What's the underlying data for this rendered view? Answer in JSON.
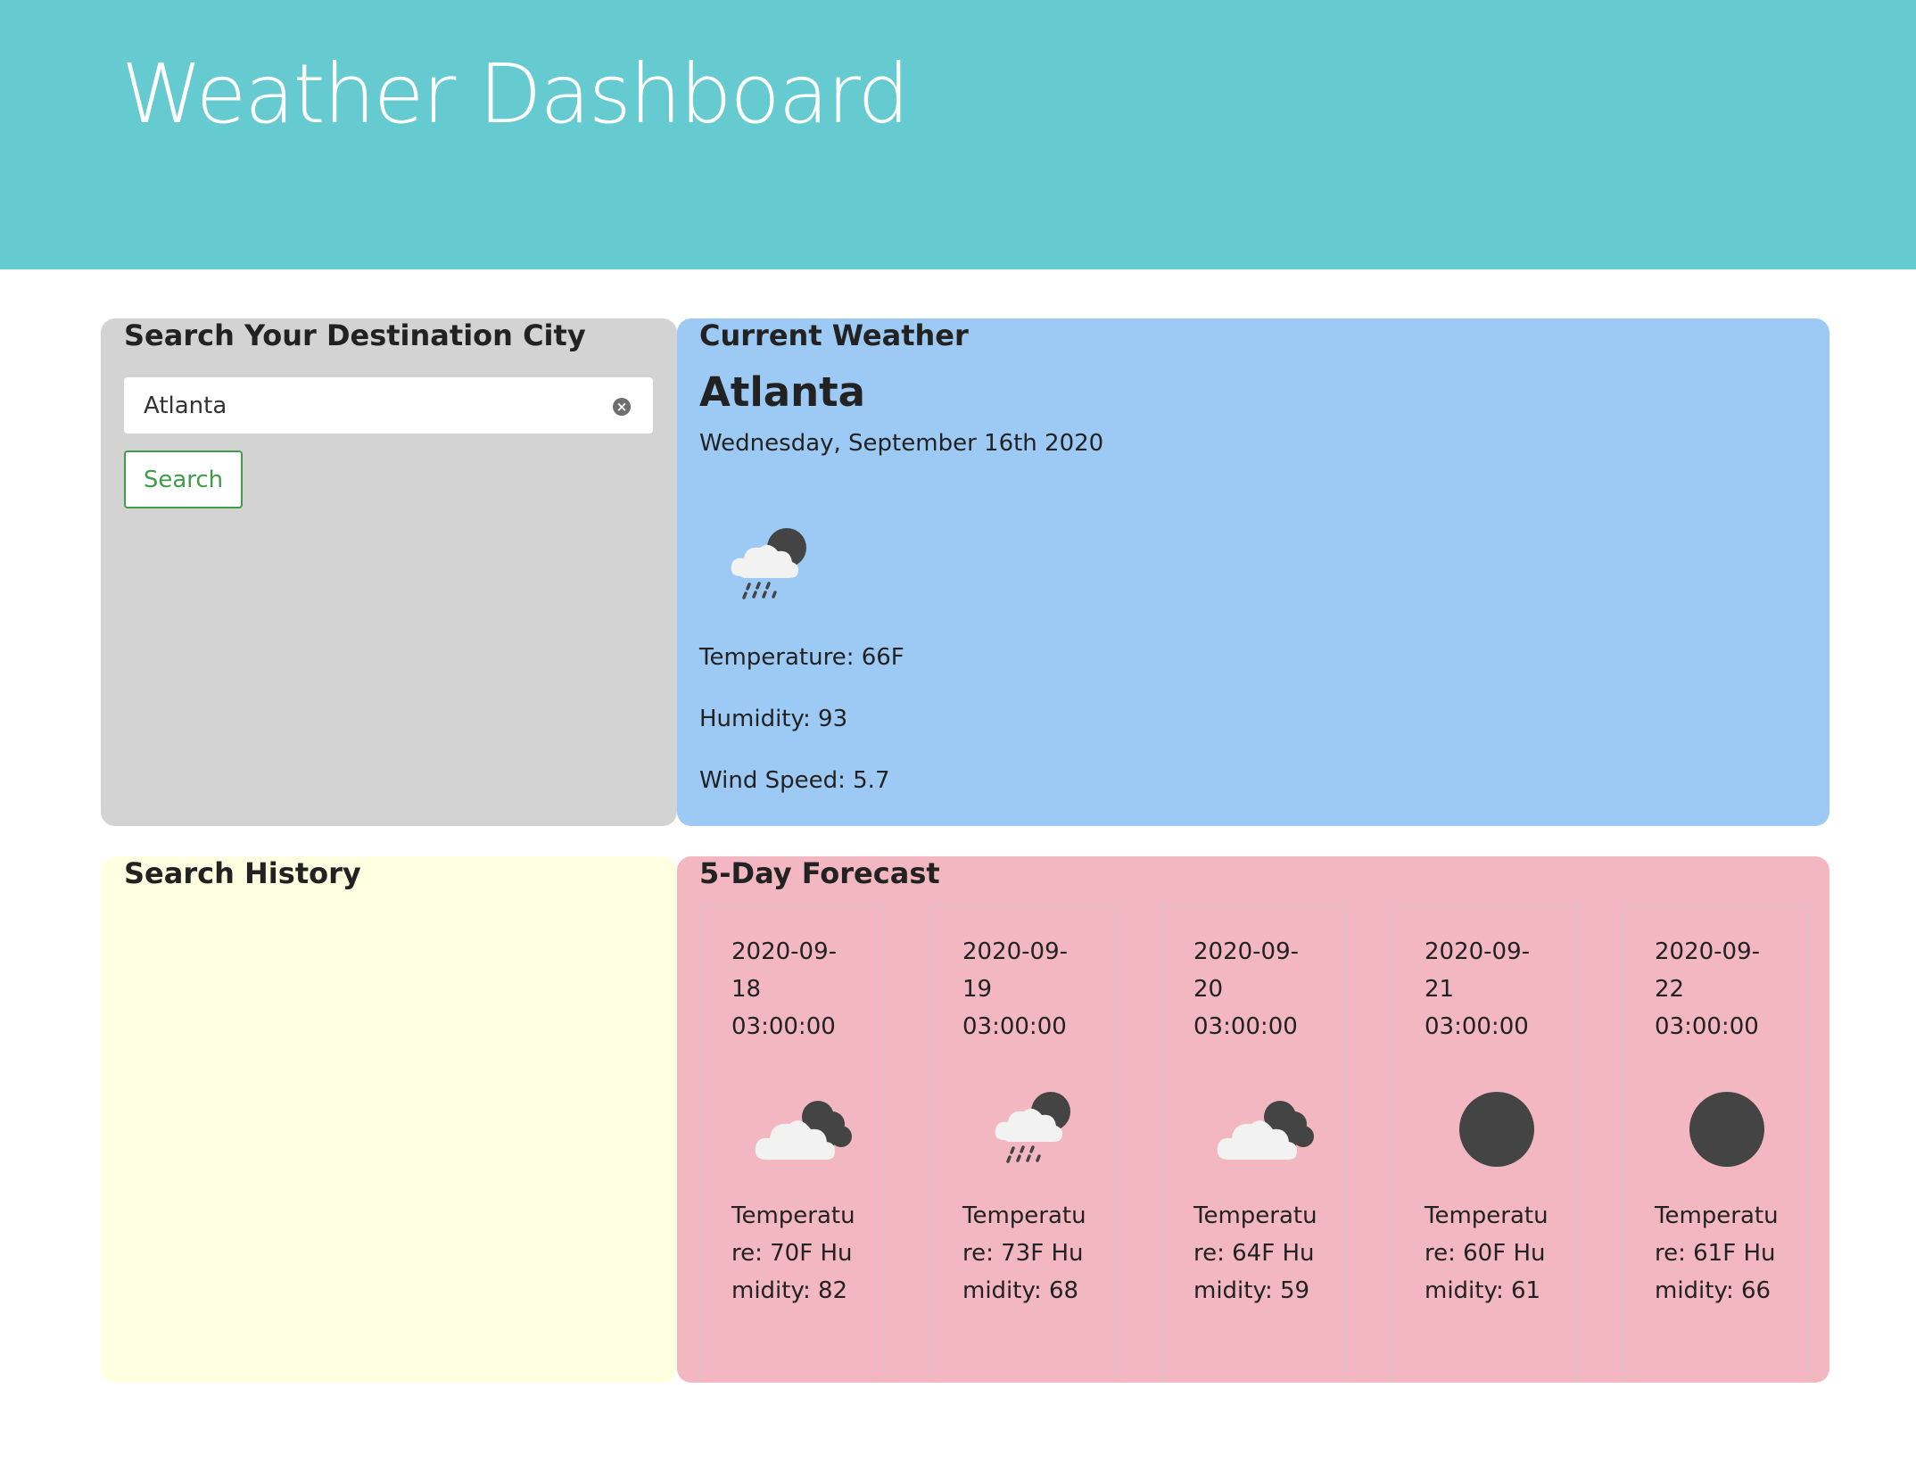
{
  "header": {
    "title": "Weather Dashboard"
  },
  "search_panel": {
    "heading": "Search Your Destination City",
    "input_value": "Atlanta",
    "clear_symbol": "×",
    "search_label": "Search"
  },
  "current": {
    "heading": "Current Weather",
    "city": "Atlanta",
    "date": "Wednesday, September 16th 2020",
    "icon": "night-cloud-rain-icon",
    "temperature": "Temperature: 66F",
    "humidity": "Humidity: 93",
    "wind": "Wind Speed: 5.7"
  },
  "history": {
    "heading": "Search History",
    "items": []
  },
  "forecast": {
    "heading": "5-Day Forecast",
    "cards": [
      {
        "datetime": "2020-09-18 03:00:00",
        "icon": "night-clouds-icon",
        "temp_humidity": "Temperature: 70F Humidity: 82"
      },
      {
        "datetime": "2020-09-19 03:00:00",
        "icon": "night-cloud-rain-icon",
        "temp_humidity": "Temperature: 73F Humidity: 68"
      },
      {
        "datetime": "2020-09-20 03:00:00",
        "icon": "night-clouds-icon",
        "temp_humidity": "Temperature: 64F Humidity: 59"
      },
      {
        "datetime": "2020-09-21 03:00:00",
        "icon": "clear-night-moon-icon",
        "temp_humidity": "Temperature: 60F Humidity: 61"
      },
      {
        "datetime": "2020-09-22 03:00:00",
        "icon": "clear-night-moon-icon",
        "temp_humidity": "Temperature: 61F Humidity: 66"
      }
    ]
  },
  "colors": {
    "header_bg": "#66cbd1",
    "search_panel_bg": "#d3d3d3",
    "current_panel_bg": "#9dcaf4",
    "history_panel_bg": "#ffffe1",
    "forecast_panel_bg": "#f2b7c1",
    "search_button": "#3f9d4a"
  }
}
